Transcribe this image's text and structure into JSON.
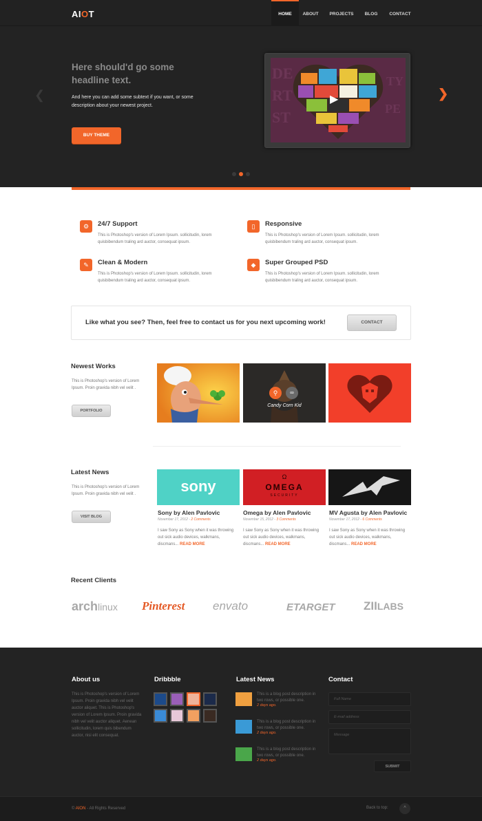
{
  "nav": {
    "logo_a": "AI",
    "logo_o": "O",
    "logo_t": "T",
    "items": [
      "HOME",
      "ABOUT",
      "PROJECTS",
      "BLOG",
      "CONTACT"
    ],
    "active": "HOME"
  },
  "hero": {
    "headline": "Here should'd go some headline text.",
    "subtext": "And here you can add some subtext if you want, or some description about your newest project.",
    "button": "BUY THEME",
    "prev_icon": "chevron-left-icon",
    "next_icon": "chevron-right-icon",
    "play_icon": "play-icon",
    "slide_count": 3,
    "active_slide": 2
  },
  "features": [
    {
      "title": "24/7 Support",
      "text": "This is Photoshop's version  of Lorem Ipsum. sollicitudin, lorem quisbibendum traling ard auctor, consequat ipsum.",
      "icon": "gear-icon"
    },
    {
      "title": "Responsive",
      "text": "This is Photoshop's version  of Lorem Ipsum. sollicitudin, lorem quisbibendum traling ard auctor, consequat ipsum.",
      "icon": "mobile-icon"
    },
    {
      "title": "Clean & Modern",
      "text": "This is Photoshop's version  of Lorem Ipsum. sollicitudin, lorem quisbibendum traling ard auctor, consequat ipsum.",
      "icon": "brush-icon"
    },
    {
      "title": "Super Grouped PSD",
      "text": "This is Photoshop's version  of Lorem Ipsum. sollicitudin, lorem quisbibendum traling ard auctor, consequat ipsum.",
      "icon": "tag-icon"
    }
  ],
  "cta": {
    "text": "Like what you see? Then, feel free to contact us for you next upcoming work!",
    "button": "CONTACT"
  },
  "works": {
    "title": "Newest Works",
    "text": "This is Photoshop's version  of Lorem Ipsum. Proin gravida nibh vel velit .",
    "button": "PORTFOLIO",
    "hover_caption": "Candy Corn Kid"
  },
  "news": {
    "title": "Latest News",
    "text": "This is Photoshop's version  of Lorem Ipsum. Proin gravida nibh vel velit .",
    "button": "VISIT BLOG",
    "posts": [
      {
        "brand": "sony",
        "title": "Sony by Alen Pavlovic",
        "date": "November 17, 2012",
        "comments": "2 Comments",
        "text": "I saw Sony as Sony when it was throwing out sick audio devices, walkmans, discmans...",
        "more": "READ MORE"
      },
      {
        "brand": "OMEGA",
        "brand_sub": "SECURITY",
        "title": "Omega by Alen Pavlovic",
        "date": "November 15, 2012",
        "comments": "3 Comments",
        "text": "I saw Sony as Sony when it was throwing out sick audio devices, walkmans, discmans...",
        "more": "READ MORE"
      },
      {
        "title": "MV Agusta by Alen Pavlovic",
        "date": "November 17, 2012",
        "comments": "6 Comments",
        "text": "I saw Sony as Sony when it was throwing out sick audio devices, walkmans, discmans...",
        "more": "READ MORE"
      }
    ]
  },
  "clients": {
    "title": "Recent Clients",
    "logos": [
      {
        "a": "arch",
        "b": "linux"
      },
      {
        "a": "Pinterest"
      },
      {
        "a": "envato"
      },
      {
        "a": "ETARGET"
      },
      {
        "a": "ZII",
        "b": "LABS"
      }
    ]
  },
  "footer": {
    "about_title": "About us",
    "about_text": "This is Photoshop's version  of Lorem Ipsum. Proin gravida nibh vel velit auctor aliquet. This is Photoshop's version  of Lorem Ipsum. Proin gravida nibh vel velit auctor aliquet. Aenean sollicitudin, lorem quis bibendum auctor, nisi elit consequat.",
    "dribbble_title": "Dribbble",
    "news_title": "Latest News",
    "news_items": [
      {
        "text": "This is a blog post description in two rows, or possible one.",
        "date": "2 days ago."
      },
      {
        "text": "This is a blog post description in two rows, or possible one.",
        "date": "2 days ago."
      },
      {
        "text": "This is a blog post description in two rows, or possible one.",
        "date": "2 days ago."
      }
    ],
    "contact_title": "Contact",
    "name_placeholder": "Full Name",
    "email_placeholder": "E-mail address",
    "message_placeholder": "Message",
    "submit": "SUBMIT"
  },
  "bottom": {
    "copy_symbol": "©",
    "brand": "AION",
    "rights": "- All Rights Reserved",
    "back_to_top": "Back to top:"
  }
}
